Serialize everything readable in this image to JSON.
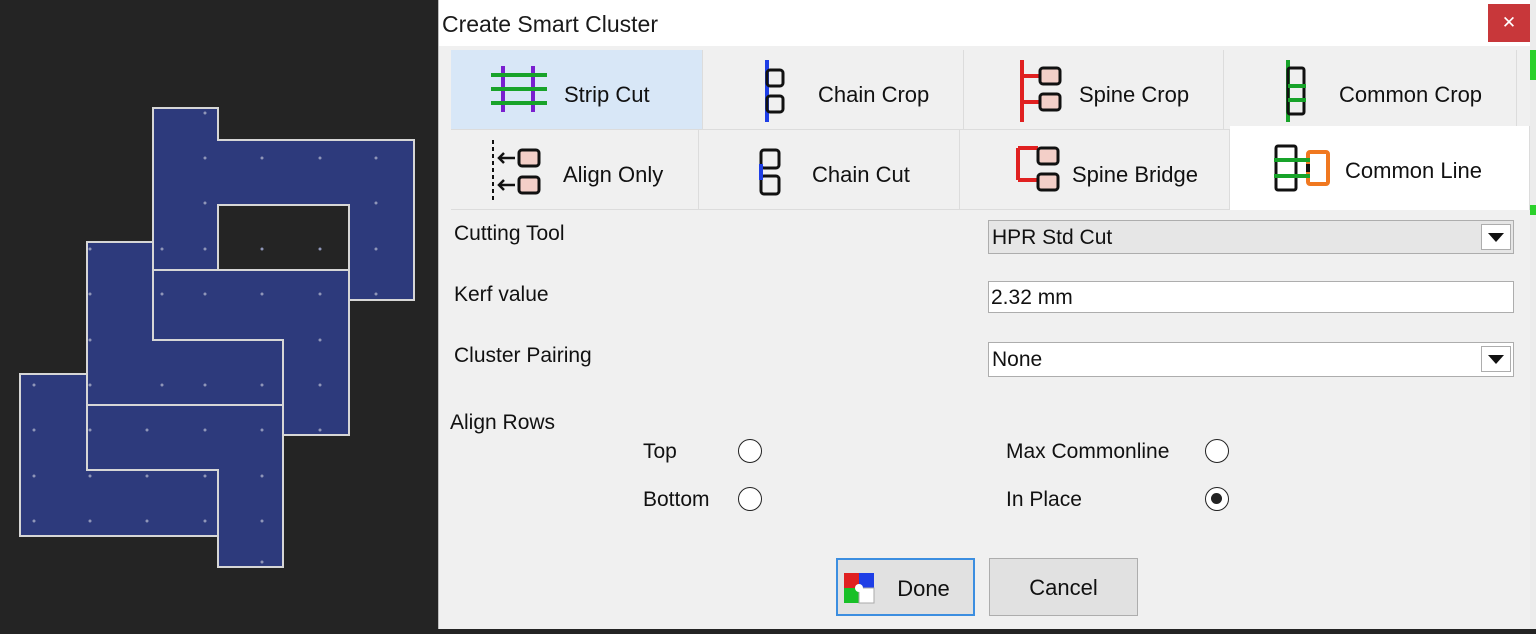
{
  "dialog": {
    "title": "Create Smart Cluster",
    "close_glyph": "✕"
  },
  "tabs": [
    {
      "label": "Strip Cut",
      "icon": "strip-cut-icon",
      "state": "selected"
    },
    {
      "label": "Chain Crop",
      "icon": "chain-crop-icon",
      "state": "normal"
    },
    {
      "label": "Spine Crop",
      "icon": "spine-crop-icon",
      "state": "normal"
    },
    {
      "label": "Common Crop",
      "icon": "common-crop-icon",
      "state": "normal"
    },
    {
      "label": "Align Only",
      "icon": "align-only-icon",
      "state": "normal"
    },
    {
      "label": "Chain Cut",
      "icon": "chain-cut-icon",
      "state": "normal"
    },
    {
      "label": "Spine Bridge",
      "icon": "spine-bridge-icon",
      "state": "normal"
    },
    {
      "label": "Common Line",
      "icon": "common-line-icon",
      "state": "current"
    }
  ],
  "form": {
    "cutting_tool": {
      "label": "Cutting Tool",
      "value": "HPR Std Cut"
    },
    "kerf": {
      "label": "Kerf value",
      "value": "2.32 mm"
    },
    "cluster_pairing": {
      "label": "Cluster Pairing",
      "value": "None"
    }
  },
  "align_rows": {
    "label": "Align Rows",
    "options": [
      {
        "label": "Top",
        "checked": false
      },
      {
        "label": "Bottom",
        "checked": false
      },
      {
        "label": "Max Commonline",
        "checked": false
      },
      {
        "label": "In Place",
        "checked": true
      }
    ]
  },
  "buttons": {
    "done": "Done",
    "cancel": "Cancel"
  },
  "colors": {
    "part_fill": "#2d3a7c",
    "part_outline": "#d6d6d6",
    "canvas_bg": "#242424",
    "selected_tab": "#d8e7f7",
    "close_button": "#c8373a"
  }
}
